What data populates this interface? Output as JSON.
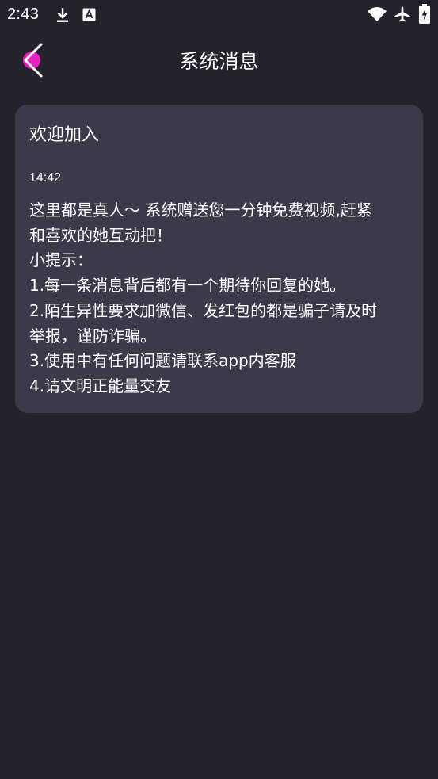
{
  "status_bar": {
    "time": "2:43",
    "icons": [
      "download-icon",
      "a-badge-icon",
      "wifi-icon",
      "airplane-icon",
      "battery-charging-icon"
    ]
  },
  "header": {
    "title": "系统消息",
    "back_icon": "chevron-left-icon",
    "back_icon_accent": "#e91ec1"
  },
  "message": {
    "title": "欢迎加入",
    "time": "14:42",
    "body_lines": [
      "这里都是真人～ 系统赠送您一分钟免费视频,赶紧",
      "和喜欢的她互动把！",
      "小提示：",
      "1.每一条消息背后都有一个期待你回复的她。",
      "2.陌生异性要求加微信、发红包的都是骗子请及时",
      "举报，谨防诈骗。",
      "3.使用中有任何问题请联系app内客服",
      "4.请文明正能量交友"
    ]
  },
  "colors": {
    "background": "#24222b",
    "card": "#3c3949",
    "text": "#ffffff"
  }
}
